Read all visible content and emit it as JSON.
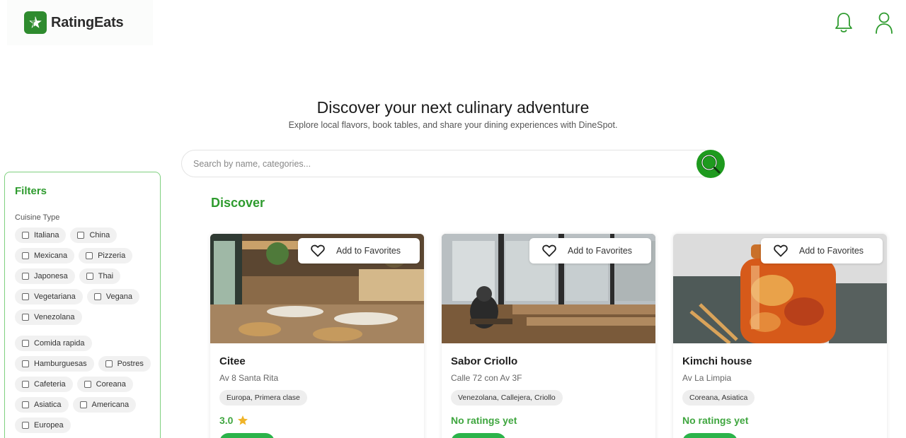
{
  "brand": {
    "name": "RatingEats",
    "color": "#2e8b2e"
  },
  "header": {
    "icons": [
      "bell-icon",
      "user-icon"
    ]
  },
  "hero": {
    "title": "Discover your next culinary adventure",
    "subtitle": "Explore local flavors, book tables, and share your dining experiences with DineSpot."
  },
  "search": {
    "placeholder": "Search by name, categories...",
    "value": ""
  },
  "filters": {
    "title": "Filters",
    "cuisine_label": "Cuisine Type",
    "options": [
      "Italiana",
      "China",
      "Mexicana",
      "Pizzeria",
      "Japonesa",
      "Thai",
      "Vegetariana",
      "Vegana",
      "Venezolana",
      "Comida rapida",
      "Hamburguesas",
      "Postres",
      "Cafeteria",
      "Coreana",
      "Asiatica",
      "Americana",
      "Europea"
    ]
  },
  "discover": {
    "title": "Discover"
  },
  "cards": [
    {
      "name": "Citee",
      "address": "Av 8 Santa Rita",
      "tags": "Europa, Primera clase",
      "rating": "3.0",
      "favorite_label": "Add to Favorites"
    },
    {
      "name": "Sabor Criollo",
      "address": "Calle 72 con Av 3F",
      "tags": "Venezolana, Callejera, Criollo",
      "rating": "No ratings yet",
      "favorite_label": "Add to Favorites"
    },
    {
      "name": "Kimchi house",
      "address": "Av La Limpia",
      "tags": "Coreana, Asiatica",
      "rating": "No ratings yet",
      "favorite_label": "Add to Favorites"
    }
  ],
  "colors": {
    "accent": "#2e9b2e",
    "search_button": "#1e9a1e",
    "star": "#f0b429"
  }
}
